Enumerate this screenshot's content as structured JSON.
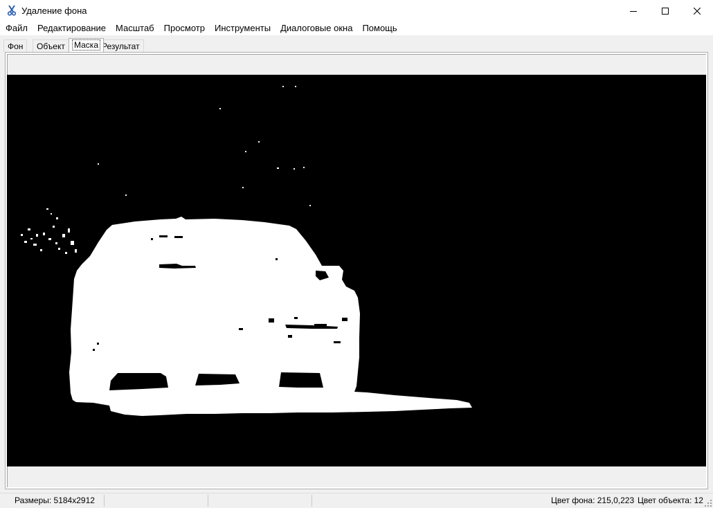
{
  "window": {
    "title": "Удаление фона",
    "icon": "scissors-icon",
    "controls": [
      "minimize-icon",
      "maximize-icon",
      "close-icon"
    ]
  },
  "menu": [
    "Файл",
    "Редактирование",
    "Масштаб",
    "Просмотр",
    "Инструменты",
    "Диалоговые окна",
    "Помощь"
  ],
  "tabs": [
    {
      "label": "Фон",
      "active": false
    },
    {
      "label": "Объект",
      "active": false
    },
    {
      "label": "Маска",
      "active": true
    },
    {
      "label": "Результат",
      "active": false
    }
  ],
  "canvas": {
    "image": "binary mask: white car silhouette on black background",
    "mask_colors": {
      "background": "#000000",
      "object": "#ffffff"
    }
  },
  "status": {
    "size": "Размеры: 5184x2912",
    "bg_color": "Цвет фона: 215,0,223",
    "obj_color": "Цвет объекта: 12"
  }
}
